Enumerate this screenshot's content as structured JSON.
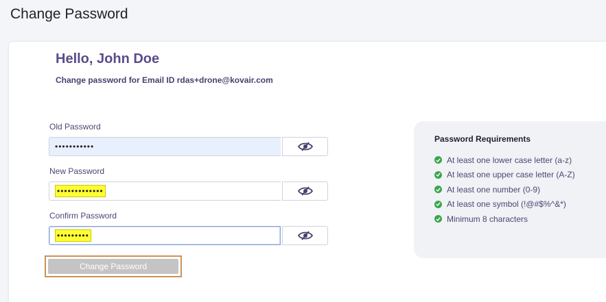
{
  "page": {
    "title": "Change Password"
  },
  "header": {
    "greeting": "Hello, John Doe",
    "subtitle": "Change password for Email ID rdas+drone@kovair.com"
  },
  "form": {
    "old_password": {
      "label": "Old Password",
      "value_masked": "•••••••••••"
    },
    "new_password": {
      "label": "New Password",
      "value_masked": "•••••••••••••"
    },
    "confirm_password": {
      "label": "Confirm Password",
      "value_masked": "•••••••••"
    },
    "toggle_icon": "eye-slash-icon",
    "submit_label": "Change Password"
  },
  "requirements": {
    "title": "Password Requirements",
    "items": [
      "At least one lower case letter (a-z)",
      "At least one upper case letter (A-Z)",
      "At least one number (0-9)",
      "At least one symbol (!@#$%^&*)",
      "Minimum 8 characters"
    ],
    "check_icon": "check-circle-icon"
  },
  "colors": {
    "accent": "#5b4b8a",
    "check": "#3aa64b",
    "button_disabled": "#c4c4c4",
    "highlight": "#ffff33"
  }
}
